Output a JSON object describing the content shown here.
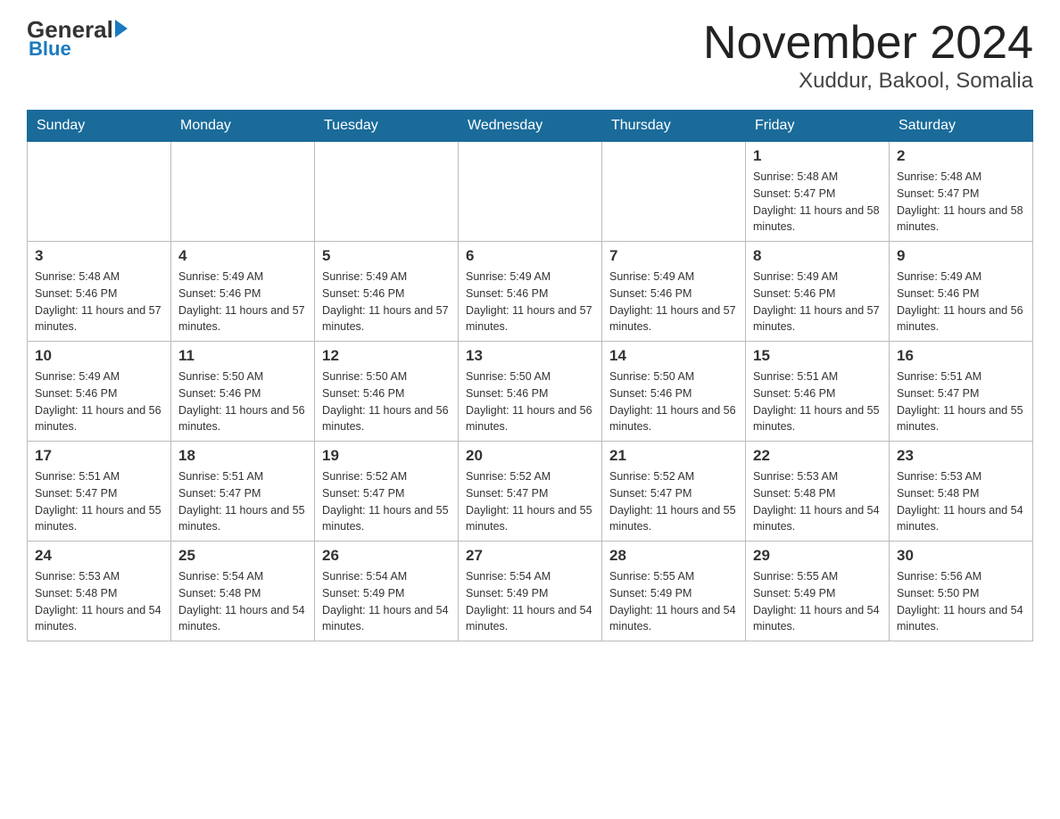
{
  "header": {
    "logo_general": "General",
    "logo_blue": "Blue",
    "month_title": "November 2024",
    "location": "Xuddur, Bakool, Somalia"
  },
  "days_of_week": [
    "Sunday",
    "Monday",
    "Tuesday",
    "Wednesday",
    "Thursday",
    "Friday",
    "Saturday"
  ],
  "weeks": [
    [
      {
        "day": "",
        "sunrise": "",
        "sunset": "",
        "daylight": ""
      },
      {
        "day": "",
        "sunrise": "",
        "sunset": "",
        "daylight": ""
      },
      {
        "day": "",
        "sunrise": "",
        "sunset": "",
        "daylight": ""
      },
      {
        "day": "",
        "sunrise": "",
        "sunset": "",
        "daylight": ""
      },
      {
        "day": "",
        "sunrise": "",
        "sunset": "",
        "daylight": ""
      },
      {
        "day": "1",
        "sunrise": "Sunrise: 5:48 AM",
        "sunset": "Sunset: 5:47 PM",
        "daylight": "Daylight: 11 hours and 58 minutes."
      },
      {
        "day": "2",
        "sunrise": "Sunrise: 5:48 AM",
        "sunset": "Sunset: 5:47 PM",
        "daylight": "Daylight: 11 hours and 58 minutes."
      }
    ],
    [
      {
        "day": "3",
        "sunrise": "Sunrise: 5:48 AM",
        "sunset": "Sunset: 5:46 PM",
        "daylight": "Daylight: 11 hours and 57 minutes."
      },
      {
        "day": "4",
        "sunrise": "Sunrise: 5:49 AM",
        "sunset": "Sunset: 5:46 PM",
        "daylight": "Daylight: 11 hours and 57 minutes."
      },
      {
        "day": "5",
        "sunrise": "Sunrise: 5:49 AM",
        "sunset": "Sunset: 5:46 PM",
        "daylight": "Daylight: 11 hours and 57 minutes."
      },
      {
        "day": "6",
        "sunrise": "Sunrise: 5:49 AM",
        "sunset": "Sunset: 5:46 PM",
        "daylight": "Daylight: 11 hours and 57 minutes."
      },
      {
        "day": "7",
        "sunrise": "Sunrise: 5:49 AM",
        "sunset": "Sunset: 5:46 PM",
        "daylight": "Daylight: 11 hours and 57 minutes."
      },
      {
        "day": "8",
        "sunrise": "Sunrise: 5:49 AM",
        "sunset": "Sunset: 5:46 PM",
        "daylight": "Daylight: 11 hours and 57 minutes."
      },
      {
        "day": "9",
        "sunrise": "Sunrise: 5:49 AM",
        "sunset": "Sunset: 5:46 PM",
        "daylight": "Daylight: 11 hours and 56 minutes."
      }
    ],
    [
      {
        "day": "10",
        "sunrise": "Sunrise: 5:49 AM",
        "sunset": "Sunset: 5:46 PM",
        "daylight": "Daylight: 11 hours and 56 minutes."
      },
      {
        "day": "11",
        "sunrise": "Sunrise: 5:50 AM",
        "sunset": "Sunset: 5:46 PM",
        "daylight": "Daylight: 11 hours and 56 minutes."
      },
      {
        "day": "12",
        "sunrise": "Sunrise: 5:50 AM",
        "sunset": "Sunset: 5:46 PM",
        "daylight": "Daylight: 11 hours and 56 minutes."
      },
      {
        "day": "13",
        "sunrise": "Sunrise: 5:50 AM",
        "sunset": "Sunset: 5:46 PM",
        "daylight": "Daylight: 11 hours and 56 minutes."
      },
      {
        "day": "14",
        "sunrise": "Sunrise: 5:50 AM",
        "sunset": "Sunset: 5:46 PM",
        "daylight": "Daylight: 11 hours and 56 minutes."
      },
      {
        "day": "15",
        "sunrise": "Sunrise: 5:51 AM",
        "sunset": "Sunset: 5:46 PM",
        "daylight": "Daylight: 11 hours and 55 minutes."
      },
      {
        "day": "16",
        "sunrise": "Sunrise: 5:51 AM",
        "sunset": "Sunset: 5:47 PM",
        "daylight": "Daylight: 11 hours and 55 minutes."
      }
    ],
    [
      {
        "day": "17",
        "sunrise": "Sunrise: 5:51 AM",
        "sunset": "Sunset: 5:47 PM",
        "daylight": "Daylight: 11 hours and 55 minutes."
      },
      {
        "day": "18",
        "sunrise": "Sunrise: 5:51 AM",
        "sunset": "Sunset: 5:47 PM",
        "daylight": "Daylight: 11 hours and 55 minutes."
      },
      {
        "day": "19",
        "sunrise": "Sunrise: 5:52 AM",
        "sunset": "Sunset: 5:47 PM",
        "daylight": "Daylight: 11 hours and 55 minutes."
      },
      {
        "day": "20",
        "sunrise": "Sunrise: 5:52 AM",
        "sunset": "Sunset: 5:47 PM",
        "daylight": "Daylight: 11 hours and 55 minutes."
      },
      {
        "day": "21",
        "sunrise": "Sunrise: 5:52 AM",
        "sunset": "Sunset: 5:47 PM",
        "daylight": "Daylight: 11 hours and 55 minutes."
      },
      {
        "day": "22",
        "sunrise": "Sunrise: 5:53 AM",
        "sunset": "Sunset: 5:48 PM",
        "daylight": "Daylight: 11 hours and 54 minutes."
      },
      {
        "day": "23",
        "sunrise": "Sunrise: 5:53 AM",
        "sunset": "Sunset: 5:48 PM",
        "daylight": "Daylight: 11 hours and 54 minutes."
      }
    ],
    [
      {
        "day": "24",
        "sunrise": "Sunrise: 5:53 AM",
        "sunset": "Sunset: 5:48 PM",
        "daylight": "Daylight: 11 hours and 54 minutes."
      },
      {
        "day": "25",
        "sunrise": "Sunrise: 5:54 AM",
        "sunset": "Sunset: 5:48 PM",
        "daylight": "Daylight: 11 hours and 54 minutes."
      },
      {
        "day": "26",
        "sunrise": "Sunrise: 5:54 AM",
        "sunset": "Sunset: 5:49 PM",
        "daylight": "Daylight: 11 hours and 54 minutes."
      },
      {
        "day": "27",
        "sunrise": "Sunrise: 5:54 AM",
        "sunset": "Sunset: 5:49 PM",
        "daylight": "Daylight: 11 hours and 54 minutes."
      },
      {
        "day": "28",
        "sunrise": "Sunrise: 5:55 AM",
        "sunset": "Sunset: 5:49 PM",
        "daylight": "Daylight: 11 hours and 54 minutes."
      },
      {
        "day": "29",
        "sunrise": "Sunrise: 5:55 AM",
        "sunset": "Sunset: 5:49 PM",
        "daylight": "Daylight: 11 hours and 54 minutes."
      },
      {
        "day": "30",
        "sunrise": "Sunrise: 5:56 AM",
        "sunset": "Sunset: 5:50 PM",
        "daylight": "Daylight: 11 hours and 54 minutes."
      }
    ]
  ]
}
